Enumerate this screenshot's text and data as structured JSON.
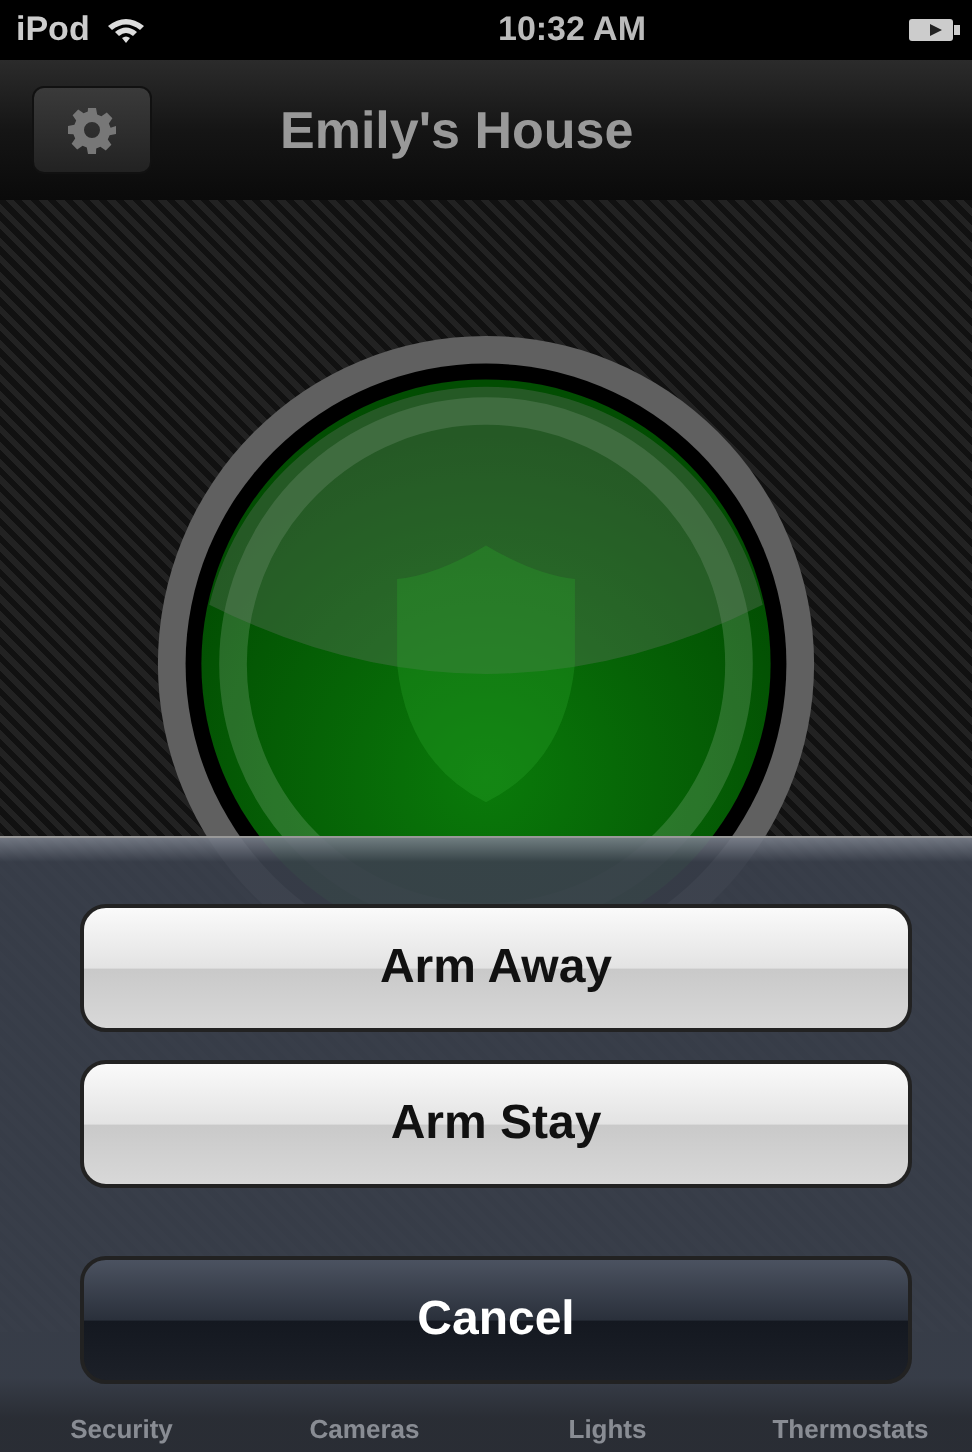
{
  "status_bar": {
    "carrier": "iPod",
    "time": "10:32 AM"
  },
  "nav_bar": {
    "title": "Emily's House"
  },
  "tab_bar": {
    "items": [
      {
        "label": "Security"
      },
      {
        "label": "Cameras"
      },
      {
        "label": "Lights"
      },
      {
        "label": "Thermostats"
      }
    ]
  },
  "action_sheet": {
    "buttons": [
      {
        "label": "Arm Away",
        "kind": "default"
      },
      {
        "label": "Arm Stay",
        "kind": "default"
      },
      {
        "label": "Cancel",
        "kind": "cancel"
      }
    ]
  }
}
